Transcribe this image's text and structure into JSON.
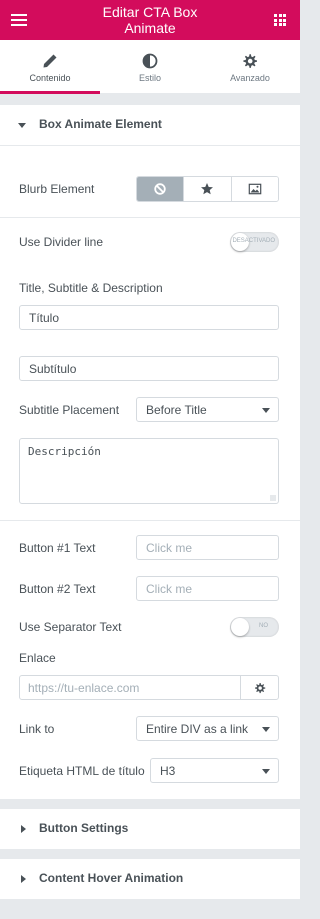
{
  "header": {
    "title_line1": "Editar CTA Box",
    "title_line2": "Animate",
    "menu_icon": "hamburger-icon",
    "apps_icon": "grid-icon"
  },
  "tabs": [
    {
      "label": "Contenido",
      "icon": "pencil-icon",
      "active": true
    },
    {
      "label": "Estilo",
      "icon": "half-circle-icon",
      "active": false
    },
    {
      "label": "Avanzado",
      "icon": "gear-icon",
      "active": false
    }
  ],
  "sections": {
    "box_animate": {
      "title": "Box Animate Element",
      "expanded": true
    },
    "button_settings": {
      "title": "Button Settings",
      "expanded": false
    },
    "content_hover": {
      "title": "Content Hover Animation",
      "expanded": false
    }
  },
  "fields": {
    "blurb_element": {
      "label": "Blurb Element",
      "options": [
        "none-icon",
        "star-icon",
        "image-icon"
      ],
      "selected": 0
    },
    "use_divider": {
      "label": "Use Divider line",
      "switch_label": "DESACTIVADO"
    },
    "title_group": {
      "label": "Title, Subtitle & Description"
    },
    "title_input": {
      "value": "Título"
    },
    "subtitle_input": {
      "value": "Subtítulo"
    },
    "subtitle_placement": {
      "label": "Subtitle Placement",
      "value": "Before Title"
    },
    "description": {
      "value": "Descripción"
    },
    "button1": {
      "label": "Button #1 Text",
      "placeholder": "Click me"
    },
    "button2": {
      "label": "Button #2 Text",
      "placeholder": "Click me"
    },
    "use_separator": {
      "label": "Use Separator Text",
      "switch_label": "NO"
    },
    "enlace": {
      "label": "Enlace",
      "placeholder": "https://tu-enlace.com"
    },
    "link_to": {
      "label": "Link to",
      "value": "Entire DIV as a link"
    },
    "title_tag": {
      "label": "Etiqueta HTML de título",
      "value": "H3"
    }
  },
  "colors": {
    "accent": "#d30c5c",
    "selected_option": "#a4afb7"
  }
}
